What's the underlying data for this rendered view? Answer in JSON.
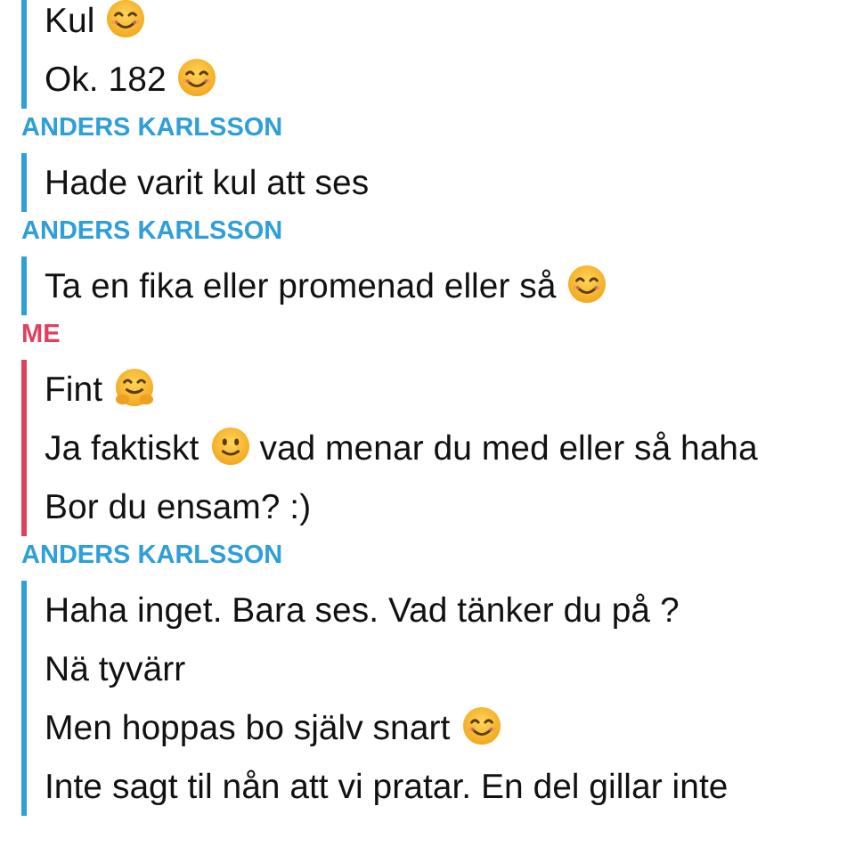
{
  "groups": [
    {
      "color": "#2e9fd8",
      "messages": [
        [
          {
            "kind": "text",
            "text": "Kul"
          },
          {
            "kind": "smiling-eyes"
          }
        ],
        [
          {
            "kind": "text",
            "text": "Ok. 182"
          },
          {
            "kind": "smiling-eyes"
          }
        ]
      ]
    },
    {
      "sender": "ANDERS KARLSSON",
      "color": "#2e9fd8",
      "messages": [
        [
          {
            "kind": "text",
            "text": "Hade varit kul att ses"
          }
        ]
      ]
    },
    {
      "sender": "ANDERS KARLSSON",
      "color": "#2e9fd8",
      "messages": [
        [
          {
            "kind": "text",
            "text": "Ta en fika eller promenad eller så"
          },
          {
            "kind": "smiling-eyes"
          }
        ]
      ]
    },
    {
      "sender": "ME",
      "color": "#e0405e",
      "messages": [
        [
          {
            "kind": "text",
            "text": "Fint"
          },
          {
            "kind": "hug"
          }
        ],
        [
          {
            "kind": "text",
            "text": "Ja faktiskt"
          },
          {
            "kind": "slight-smile"
          },
          {
            "kind": "text",
            "text": "vad menar du med eller så haha"
          }
        ],
        [
          {
            "kind": "text",
            "text": "Bor du ensam? :)"
          }
        ]
      ]
    },
    {
      "sender": "ANDERS KARLSSON",
      "color": "#2e9fd8",
      "messages": [
        [
          {
            "kind": "text",
            "text": "Haha inget. Bara ses. Vad tänker du på ?"
          }
        ],
        [
          {
            "kind": "text",
            "text": "Nä tyvärr"
          }
        ],
        [
          {
            "kind": "text",
            "text": "Men hoppas bo själv snart"
          },
          {
            "kind": "smiling-eyes"
          }
        ],
        [
          {
            "kind": "text",
            "text": "Inte sagt til nån att vi pratar. En del gillar inte"
          }
        ]
      ]
    }
  ]
}
